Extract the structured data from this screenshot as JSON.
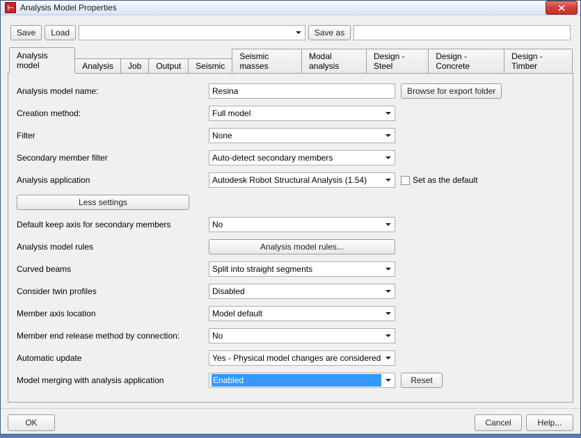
{
  "window": {
    "title": "Analysis Model Properties"
  },
  "toolbar": {
    "save": "Save",
    "load": "Load",
    "saveas": "Save as",
    "preset_value": "",
    "saveas_value": ""
  },
  "tabs": [
    "Analysis model",
    "Analysis",
    "Job",
    "Output",
    "Seismic",
    "Seismic masses",
    "Modal analysis",
    "Design - Steel",
    "Design - Concrete",
    "Design - Timber"
  ],
  "form": {
    "model_name_label": "Analysis model name:",
    "model_name_value": "Resina",
    "browse_btn": "Browse for export folder",
    "creation_label": "Creation method:",
    "creation_value": "Full model",
    "filter_label": "Filter",
    "filter_value": "None",
    "secondary_filter_label": "Secondary member filter",
    "secondary_filter_value": "Auto-detect secondary members",
    "app_label": "Analysis application",
    "app_value": "Autodesk Robot Structural Analysis (1.54)",
    "set_default_label": "Set as the default",
    "less_settings": "Less settings",
    "keep_axis_label": "Default keep axis for secondary members",
    "keep_axis_value": "No",
    "rules_label": "Analysis model rules",
    "rules_btn": "Analysis model rules...",
    "curved_label": "Curved beams",
    "curved_value": "Split into straight segments",
    "twin_label": "Consider twin profiles",
    "twin_value": "Disabled",
    "axis_loc_label": "Member axis location",
    "axis_loc_value": "Model default",
    "release_label": "Member end release method by connection:",
    "release_value": "No",
    "auto_update_label": "Automatic update",
    "auto_update_value": "Yes - Physical model changes are considered",
    "merging_label": "Model merging with analysis application",
    "merging_value": "Enabled",
    "reset_btn": "Reset"
  },
  "footer": {
    "ok": "OK",
    "cancel": "Cancel",
    "help": "Help..."
  }
}
